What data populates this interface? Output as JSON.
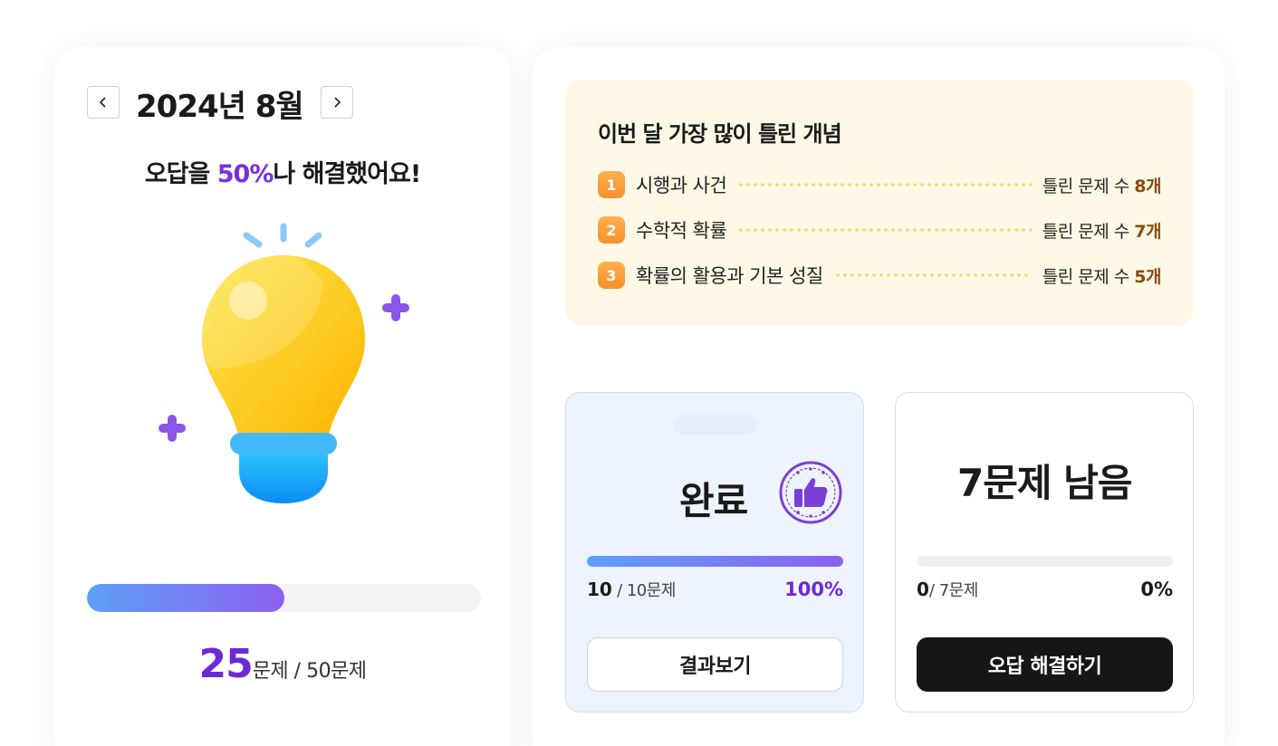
{
  "month_nav": {
    "title": "2024년 8월",
    "prev_icon": "chevron-left-icon",
    "next_icon": "chevron-right-icon"
  },
  "summary": {
    "headline_prefix": "오답을 ",
    "headline_percent": "50%",
    "headline_suffix": "나 해결했어요!",
    "progress_fraction": 0.5,
    "solved": "25",
    "solved_suffix": "문제 / 50문제",
    "illustration": "lightbulb-icon"
  },
  "concepts": {
    "title": "이번 달 가장 많이 틀린 개념",
    "count_label": "틀린 문제 수 ",
    "items": [
      {
        "rank": "1",
        "name": "시행과 사건",
        "count": "8개"
      },
      {
        "rank": "2",
        "name": "수학적 확률",
        "count": "7개"
      },
      {
        "rank": "3",
        "name": "확률의 활용과 기본 성질",
        "count": "5개"
      }
    ]
  },
  "done_card": {
    "title": "완료",
    "stamp_icon": "thumbs-up-stamp-icon",
    "progress_fraction": 1.0,
    "count": "10",
    "count_suffix": " / 10문제",
    "percent": "100%",
    "button_label": "결과보기"
  },
  "todo_card": {
    "title": "7문제 남음",
    "progress_fraction": 0.0,
    "count": "0",
    "count_suffix": "/ 7문제",
    "percent": "0%",
    "button_label": "오답 해결하기"
  },
  "colors": {
    "accent_purple": "#6d28d9",
    "progress_start": "#5ea0f8",
    "progress_end": "#8d60f0",
    "rank_badge": "#f98f2a",
    "concept_bg": "#fdf9e6",
    "count_brown": "#8a4a12"
  }
}
